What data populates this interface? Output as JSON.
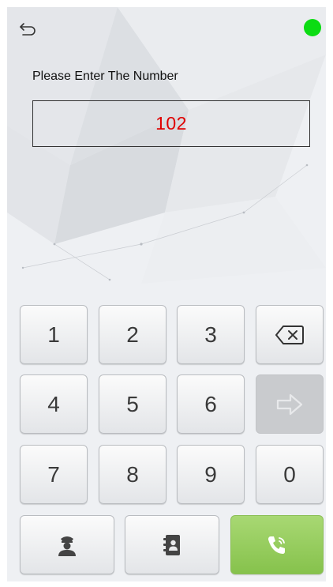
{
  "prompt": "Please Enter The Number",
  "entered_number": "102",
  "keypad": {
    "rows": [
      [
        "1",
        "2",
        "3"
      ],
      [
        "4",
        "5",
        "6"
      ],
      [
        "7",
        "8",
        "9"
      ]
    ],
    "zero": "0"
  },
  "icons": {
    "back": "back-arrow-icon",
    "status": "status-dot-icon",
    "backspace": "backspace-icon",
    "confirm": "arrow-right-icon",
    "guard": "security-guard-icon",
    "contacts": "contacts-book-icon",
    "call": "phone-call-icon"
  },
  "colors": {
    "status_online": "#0cdc13",
    "number_text": "#e00000",
    "call_button": "#96cc5e"
  }
}
